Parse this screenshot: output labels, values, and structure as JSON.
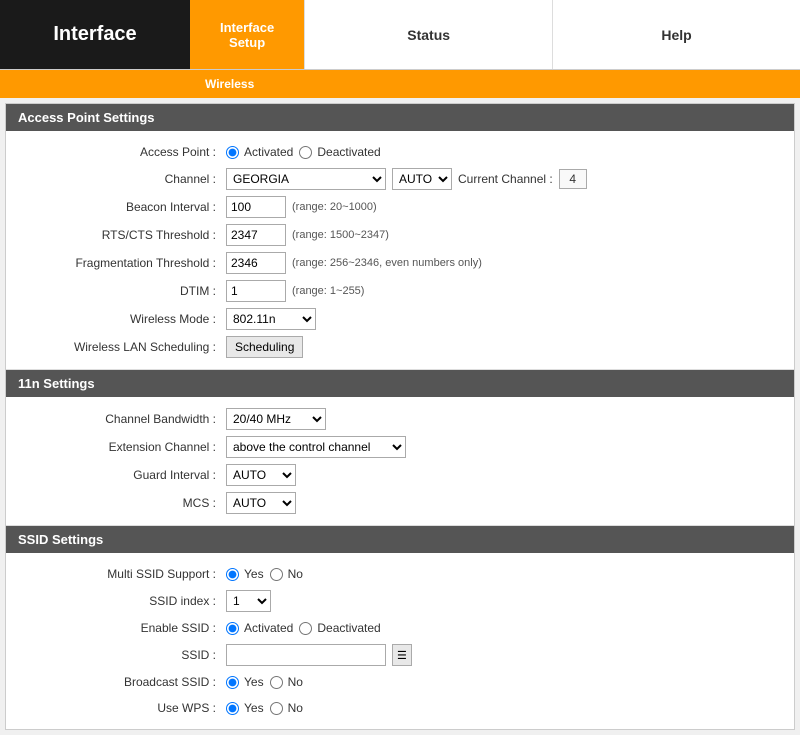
{
  "header": {
    "logo": "Interface",
    "tabs": [
      {
        "id": "interface-setup",
        "label": "Interface\nSetup",
        "active": true
      },
      {
        "id": "status",
        "label": "Status",
        "active": false
      },
      {
        "id": "help",
        "label": "Help",
        "active": false
      }
    ],
    "subnav": "Wireless"
  },
  "sections": {
    "access_point": {
      "title": "Access Point Settings",
      "fields": {
        "access_point_label": "Access Point :",
        "activated_label": "Activated",
        "deactivated_label": "Deactivated",
        "channel_label": "Channel :",
        "channel_value": "GEORGIA",
        "auto_label": "AUTO",
        "current_channel_label": "Current Channel :",
        "current_channel_value": "4",
        "beacon_interval_label": "Beacon Interval :",
        "beacon_interval_value": "100",
        "beacon_interval_hint": "(range: 20~1000)",
        "rts_label": "RTS/CTS Threshold :",
        "rts_value": "2347",
        "rts_hint": "(range: 1500~2347)",
        "frag_label": "Fragmentation Threshold :",
        "frag_value": "2346",
        "frag_hint": "(range: 256~2346, even numbers only)",
        "dtim_label": "DTIM :",
        "dtim_value": "1",
        "dtim_hint": "(range: 1~255)",
        "wireless_mode_label": "Wireless Mode :",
        "wireless_mode_value": "802.11n",
        "wireless_lan_label": "Wireless LAN Scheduling :",
        "scheduling_btn": "Scheduling"
      }
    },
    "settings_11n": {
      "title": "11n Settings",
      "fields": {
        "channel_bw_label": "Channel Bandwidth :",
        "channel_bw_value": "20/40 MHz",
        "ext_channel_label": "Extension Channel :",
        "ext_channel_value": "above the control channel",
        "guard_interval_label": "Guard Interval :",
        "guard_interval_value": "AUTO",
        "mcs_label": "MCS :",
        "mcs_value": "AUTO"
      }
    },
    "ssid": {
      "title": "SSID Settings",
      "fields": {
        "multi_ssid_label": "Multi SSID Support :",
        "yes_label": "Yes",
        "no_label": "No",
        "ssid_index_label": "SSID index :",
        "ssid_index_value": "1",
        "enable_ssid_label": "Enable SSID :",
        "enable_activated": "Activated",
        "enable_deactivated": "Deactivated",
        "ssid_label": "SSID :",
        "broadcast_ssid_label": "Broadcast SSID :",
        "broadcast_yes": "Yes",
        "broadcast_no": "No",
        "use_wps_label": "Use WPS :",
        "wps_yes": "Yes",
        "wps_no": "No"
      }
    }
  }
}
